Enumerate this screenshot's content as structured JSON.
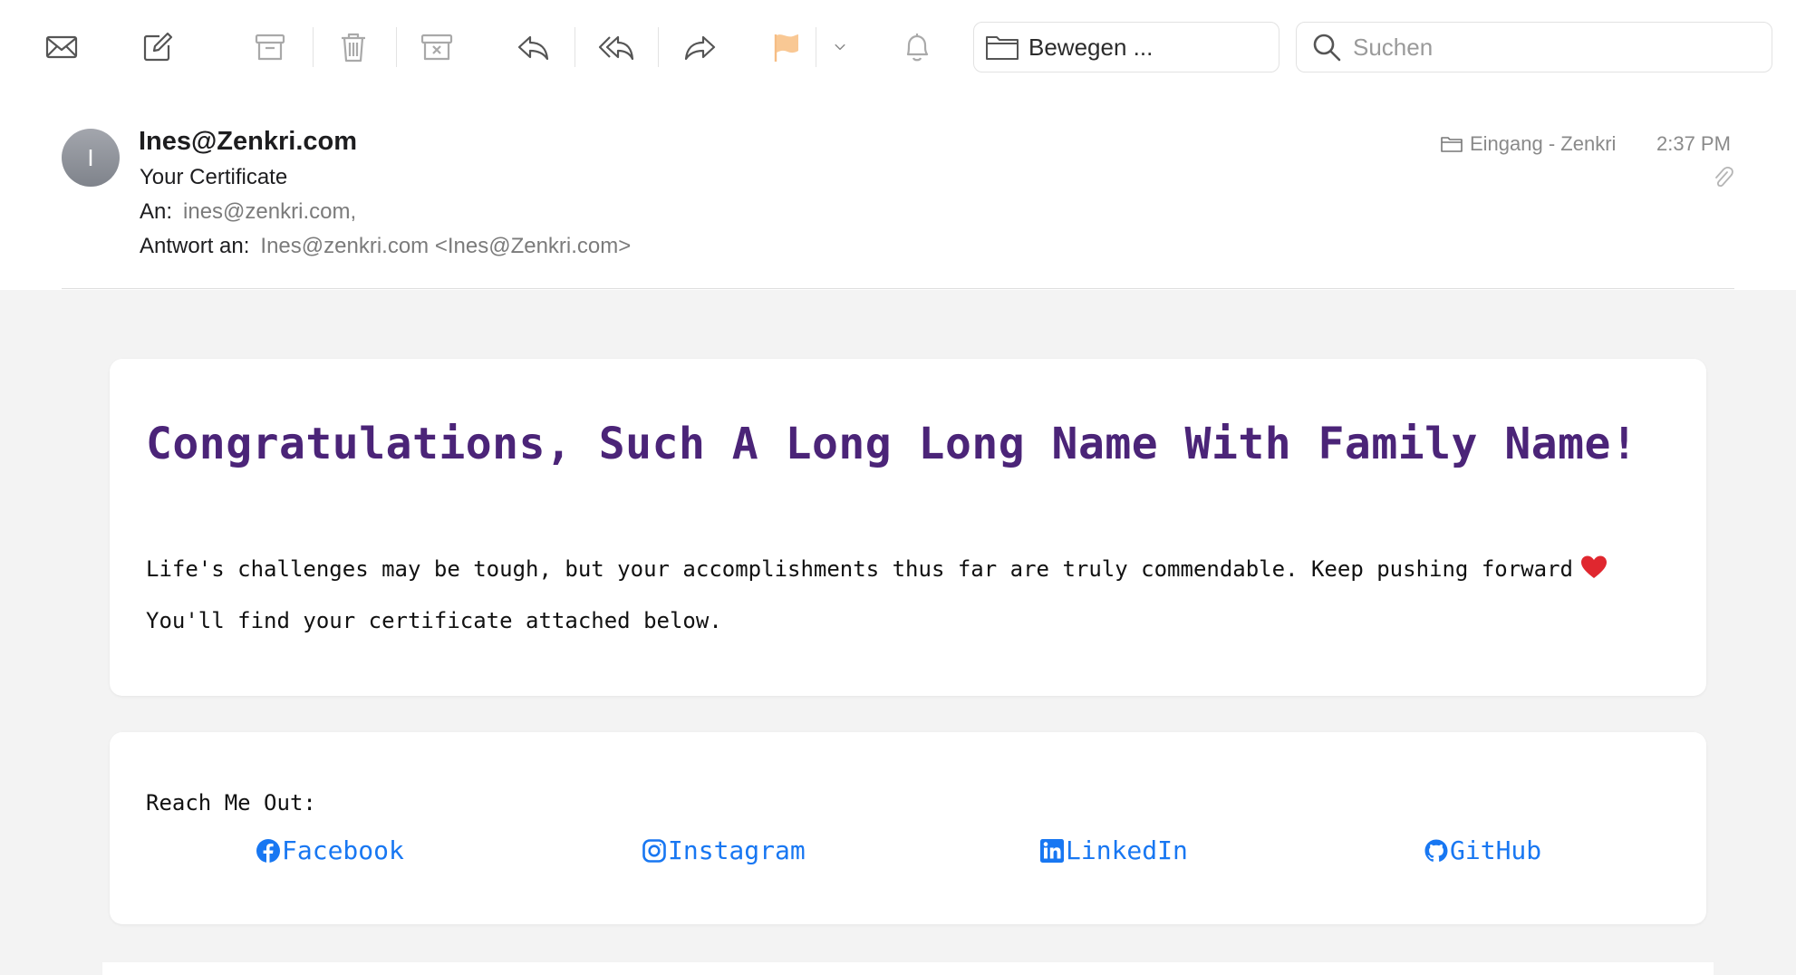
{
  "toolbar": {
    "buttons": [
      {
        "name": "get-mail",
        "icon": "envelope-icon"
      },
      {
        "name": "compose",
        "icon": "compose-icon"
      },
      {
        "name": "archive",
        "icon": "archive-icon"
      },
      {
        "name": "delete",
        "icon": "trash-icon"
      },
      {
        "name": "junk",
        "icon": "junk-icon"
      },
      {
        "name": "reply",
        "icon": "reply-icon"
      },
      {
        "name": "reply-all",
        "icon": "reply-all-icon"
      },
      {
        "name": "forward",
        "icon": "forward-icon"
      },
      {
        "name": "flag",
        "icon": "flag-icon",
        "color": "#f9c894"
      },
      {
        "name": "flag-menu",
        "icon": "chevron-down-icon"
      },
      {
        "name": "notify",
        "icon": "bell-icon"
      }
    ],
    "move_label": "Bewegen ...",
    "search_placeholder": "Suchen"
  },
  "message": {
    "avatar_initial": "I",
    "sender": "Ines@Zenkri.com",
    "subject": "Your Certificate",
    "to_label": "An:",
    "to_value": "ines@zenkri.com,",
    "reply_to_label": "Antwort an:",
    "reply_to_value": "Ines@zenkri.com <Ines@Zenkri.com>",
    "mailbox": "Eingang - Zenkri",
    "time": "2:37 PM"
  },
  "email_body": {
    "heading": "Congratulations, Such A Long Long Name With Family Name!",
    "line1": "Life's challenges may be tough, but your accomplishments thus far are truly commendable. Keep pushing forward",
    "line2": "You'll find your certificate attached below.",
    "reach_label": "Reach Me Out:",
    "links": {
      "facebook": "Facebook",
      "instagram": "Instagram",
      "linkedin": "LinkedIn",
      "github": "GitHub"
    }
  },
  "colors": {
    "heading": "#4b2478",
    "link": "#1877f2",
    "body_background": "#f3f3f3",
    "heart": "#e0272f"
  }
}
